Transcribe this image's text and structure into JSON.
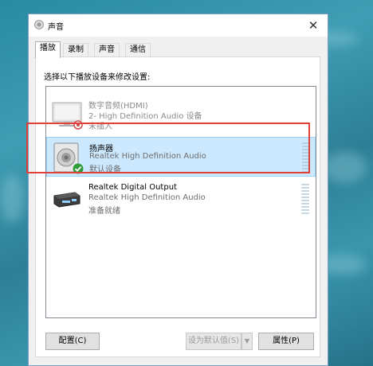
{
  "window": {
    "title": "声音"
  },
  "tabs": [
    {
      "label": "播放",
      "active": true
    },
    {
      "label": "录制",
      "active": false
    },
    {
      "label": "声音",
      "active": false
    },
    {
      "label": "通信",
      "active": false
    }
  ],
  "playback": {
    "instruction": "选择以下播放设备来修改设置:",
    "devices": [
      {
        "name": "数字音频(HDMI)",
        "description": "2- High Definition Audio 设备",
        "status": "未插入",
        "icon": "monitor-icon",
        "state": "disabled"
      },
      {
        "name": "扬声器",
        "description": "Realtek High Definition Audio",
        "status": "默认设备",
        "icon": "speaker-icon",
        "state": "default-selected"
      },
      {
        "name": "Realtek Digital Output",
        "description": "Realtek High Definition Audio",
        "status": "准备就绪",
        "icon": "digital-output-icon",
        "state": "ready"
      }
    ]
  },
  "buttons": {
    "configure": "配置(C)",
    "set_default": "设为默认值(S)",
    "properties": "属性(P)"
  },
  "colors": {
    "selection_bg": "#cce8ff",
    "highlight_border": "#e0403a",
    "check_green": "#2e9e3a"
  }
}
